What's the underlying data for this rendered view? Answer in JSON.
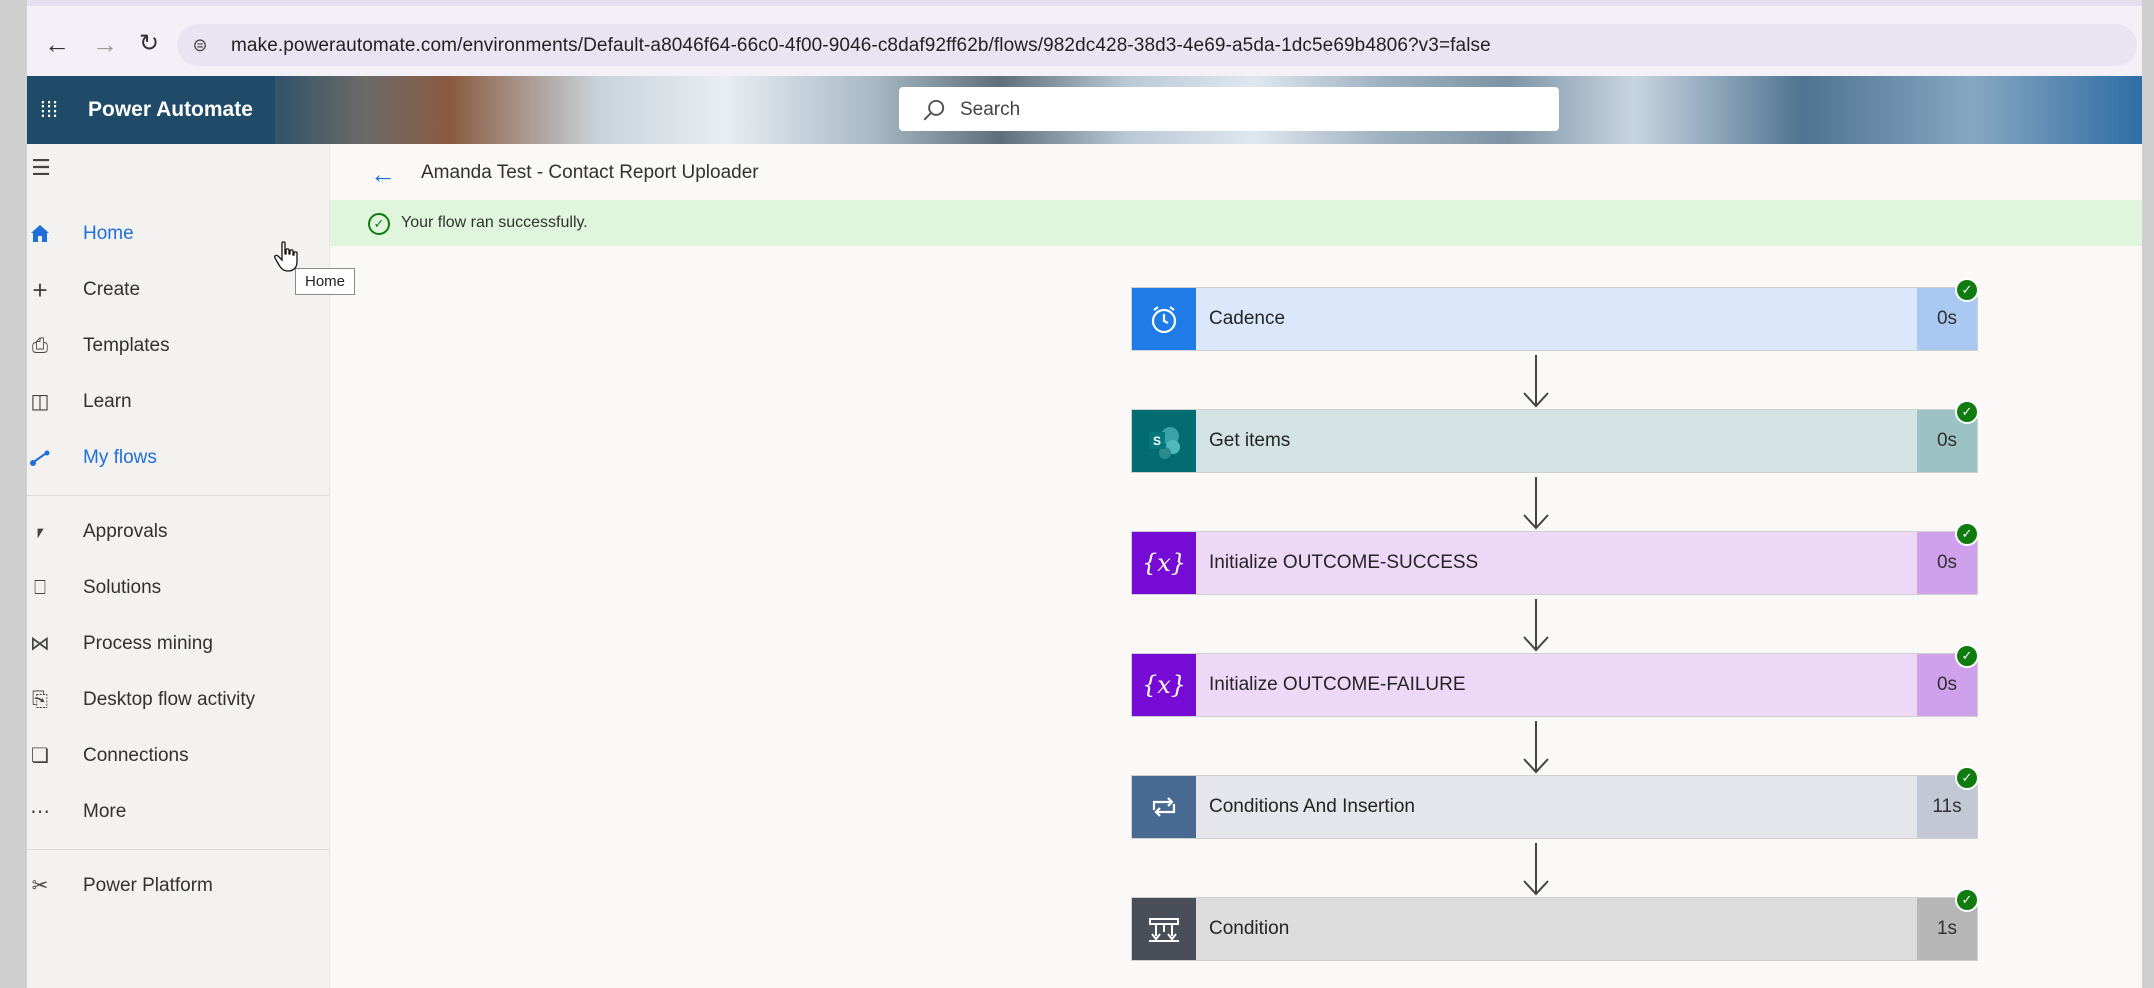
{
  "browser": {
    "url": "make.powerautomate.com/environments/Default-a8046f64-66c0-4f00-9046-c8daf92ff62b/flows/982dc428-38d3-4e69-a5da-1dc5e69b4806?v3=false",
    "back_icon": "arrow-left",
    "forward_icon": "arrow-right",
    "reload_icon": "reload"
  },
  "header": {
    "app_title": "Power Automate",
    "search_placeholder": "Search"
  },
  "sidebar": {
    "items": [
      {
        "label": "Home",
        "icon": "home-icon"
      },
      {
        "label": "Create",
        "icon": "plus-icon"
      },
      {
        "label": "Templates",
        "icon": "templates-icon"
      },
      {
        "label": "Learn",
        "icon": "book-icon"
      },
      {
        "label": "My flows",
        "icon": "flows-icon"
      },
      {
        "label": "Approvals",
        "icon": "approvals-icon"
      },
      {
        "label": "Solutions",
        "icon": "solutions-icon"
      },
      {
        "label": "Process mining",
        "icon": "process-mining-icon"
      },
      {
        "label": "Desktop flow activity",
        "icon": "desktop-activity-icon"
      },
      {
        "label": "Connections",
        "icon": "connections-icon"
      },
      {
        "label": "More",
        "icon": "ellipsis-icon"
      },
      {
        "label": "Power Platform",
        "icon": "power-platform-icon"
      }
    ],
    "tooltip": "Home"
  },
  "main": {
    "flow_title": "Amanda Test - Contact Report Uploader",
    "banner_text": "Your flow ran successfully.",
    "steps": [
      {
        "name": "Cadence",
        "duration": "0s",
        "tile_color": "#1e7be8",
        "body_color": "#dbe8fb",
        "dur_color": "#a9c9f3",
        "icon": "alarm-clock-icon"
      },
      {
        "name": "Get items",
        "duration": "0s",
        "tile_color": "#036c70",
        "body_color": "#d3e3e4",
        "dur_color": "#9dc2c3",
        "icon": "sharepoint-icon"
      },
      {
        "name": "Initialize OUTCOME-SUCCESS",
        "duration": "0s",
        "tile_color": "#770bd6",
        "body_color": "#eed8f7",
        "dur_color": "#cfa0ec",
        "icon": "variable-icon"
      },
      {
        "name": "Initialize OUTCOME-FAILURE",
        "duration": "0s",
        "tile_color": "#770bd6",
        "body_color": "#eed8f7",
        "dur_color": "#cfa0ec",
        "icon": "variable-icon"
      },
      {
        "name": "Conditions And Insertion",
        "duration": "11s",
        "tile_color": "#486991",
        "body_color": "#e4e6ec",
        "dur_color": "#c3c9d4",
        "icon": "loop-icon"
      },
      {
        "name": "Condition",
        "duration": "1s",
        "tile_color": "#484f58",
        "body_color": "#dcdcdc",
        "dur_color": "#b6b6b6",
        "icon": "condition-icon"
      }
    ]
  }
}
